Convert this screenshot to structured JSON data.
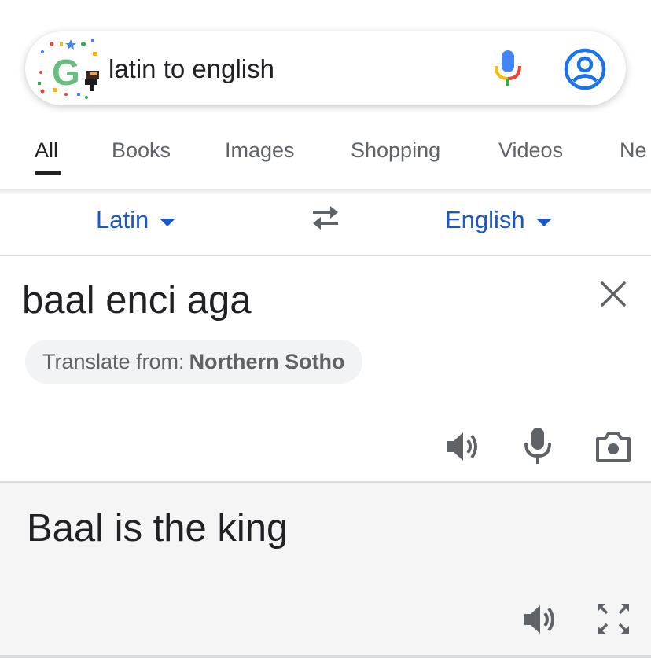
{
  "search": {
    "query": "latin to english"
  },
  "tabs": [
    {
      "label": "All",
      "active": true
    },
    {
      "label": "Books",
      "active": false
    },
    {
      "label": "Images",
      "active": false
    },
    {
      "label": "Shopping",
      "active": false
    },
    {
      "label": "Videos",
      "active": false
    },
    {
      "label": "Ne",
      "active": false
    }
  ],
  "translator": {
    "source_language": "Latin",
    "target_language": "English",
    "source_text": "baal enci aga",
    "detect_prefix": "Translate from:",
    "detected_language": "Northern Sotho",
    "result_text": "Baal is the king"
  },
  "icons": {
    "doodle": "google-doodle-icon",
    "mic": "microphone-icon",
    "account": "account-icon",
    "swap": "swap-languages-icon",
    "clear": "close-icon",
    "speaker": "speaker-icon",
    "camera": "camera-icon",
    "expand": "fullscreen-icon"
  },
  "colors": {
    "accent_blue": "#1a57c7",
    "text_primary": "#202124",
    "text_secondary": "#5f6368",
    "result_background": "#f5f5f5",
    "icon_gray": "#5f6368",
    "mic_blue": "#4285f4",
    "mic_red": "#ea4335",
    "mic_yellow": "#fbbc05",
    "mic_green": "#34a853"
  }
}
